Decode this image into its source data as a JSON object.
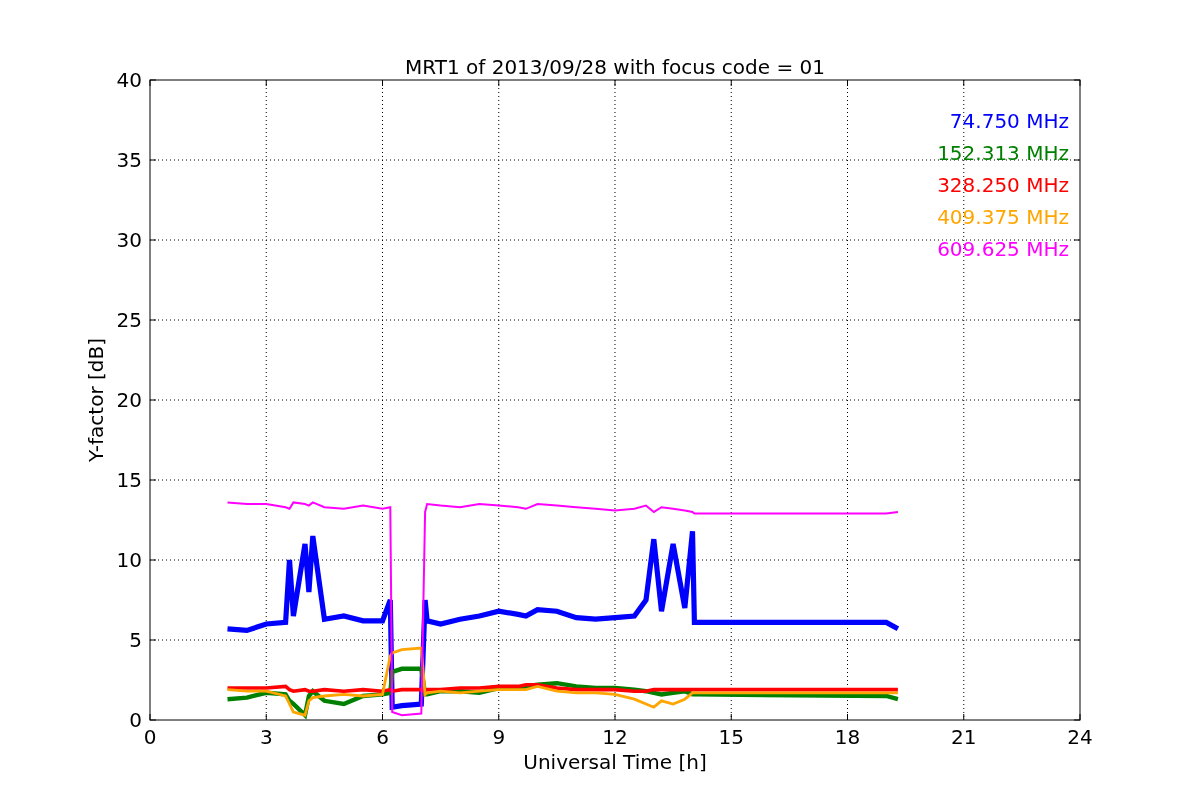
{
  "chart_data": {
    "type": "line",
    "title": "MRT1 of 2013/09/28 with focus code = 01",
    "xlabel": "Universal Time [h]",
    "ylabel": "Y-factor [dB]",
    "x": [
      2.0,
      2.5,
      3.0,
      3.5,
      3.6,
      3.7,
      4.0,
      4.1,
      4.2,
      4.5,
      5,
      5.5,
      6,
      6.2,
      6.25,
      6.5,
      7,
      7.1,
      7.15,
      7.5,
      8,
      8.5,
      9,
      9.5,
      9.7,
      10,
      10.5,
      11,
      11.5,
      12,
      12.5,
      12.8,
      13,
      13.2,
      13.5,
      13.8,
      14,
      14.05,
      19,
      19.3
    ],
    "series": [
      {
        "name": "74.750 MHz",
        "color": "#0000ff",
        "values": [
          5.7,
          5.6,
          6.0,
          6.1,
          10,
          6.5,
          11,
          8,
          11.5,
          6.3,
          6.5,
          6.2,
          6.2,
          7.5,
          0.8,
          0.9,
          1.0,
          7.5,
          6.2,
          6.0,
          6.3,
          6.5,
          6.8,
          6.6,
          6.5,
          6.9,
          6.8,
          6.4,
          6.3,
          6.4,
          6.5,
          7.5,
          11.3,
          6.8,
          11.0,
          7.0,
          11.8,
          6.1,
          6.1,
          5.7
        ]
      },
      {
        "name": "152.313 MHz",
        "color": "#008000",
        "values": [
          1.3,
          1.4,
          1.7,
          1.6,
          1.2,
          1.0,
          0.3,
          1.5,
          1.8,
          1.2,
          1.0,
          1.5,
          1.6,
          1.7,
          3.0,
          3.2,
          3.2,
          1.6,
          1.6,
          1.8,
          1.8,
          1.7,
          2.0,
          2.0,
          2.1,
          2.2,
          2.3,
          2.1,
          2.0,
          2.0,
          1.9,
          1.8,
          1.7,
          1.6,
          1.7,
          1.8,
          1.6,
          1.6,
          1.5,
          1.3
        ]
      },
      {
        "name": "328.250 MHz",
        "color": "#ff0000",
        "values": [
          2.0,
          2.0,
          2.0,
          2.1,
          1.9,
          1.8,
          1.9,
          1.8,
          1.8,
          1.9,
          1.8,
          1.9,
          1.8,
          1.9,
          1.8,
          1.9,
          1.9,
          1.8,
          1.9,
          1.9,
          2.0,
          2.0,
          2.1,
          2.1,
          2.2,
          2.2,
          2.0,
          1.9,
          1.9,
          1.9,
          1.8,
          1.8,
          1.9,
          1.9,
          1.9,
          1.9,
          1.9,
          1.9,
          1.9,
          1.9
        ]
      },
      {
        "name": "409.375 MHz",
        "color": "#ffa500",
        "values": [
          1.9,
          1.8,
          1.8,
          1.5,
          1.0,
          0.5,
          0.3,
          1.2,
          1.4,
          1.5,
          1.6,
          1.5,
          1.6,
          4.0,
          4.2,
          4.4,
          4.5,
          1.6,
          1.7,
          1.8,
          1.7,
          1.8,
          1.9,
          1.9,
          1.9,
          2.1,
          1.8,
          1.7,
          1.7,
          1.6,
          1.3,
          1.0,
          0.8,
          1.2,
          1.0,
          1.3,
          1.7,
          1.7,
          1.7,
          1.7
        ]
      },
      {
        "name": "609.625 MHz",
        "color": "#ff00ff",
        "values": [
          13.6,
          13.5,
          13.5,
          13.3,
          13.2,
          13.6,
          13.5,
          13.4,
          13.6,
          13.3,
          13.2,
          13.4,
          13.2,
          13.3,
          0.5,
          0.3,
          0.4,
          13,
          13.5,
          13.4,
          13.3,
          13.5,
          13.4,
          13.3,
          13.2,
          13.5,
          13.4,
          13.3,
          13.2,
          13.1,
          13.2,
          13.4,
          13.0,
          13.3,
          13.2,
          13.1,
          13.0,
          12.9,
          12.9,
          13.0
        ]
      }
    ],
    "grid": true,
    "xlim": [
      0,
      24
    ],
    "ylim": [
      0,
      40
    ],
    "xticks": [
      0,
      3,
      6,
      9,
      12,
      15,
      18,
      21,
      24
    ],
    "yticks": [
      0,
      5,
      10,
      15,
      20,
      25,
      30,
      35,
      40
    ]
  }
}
